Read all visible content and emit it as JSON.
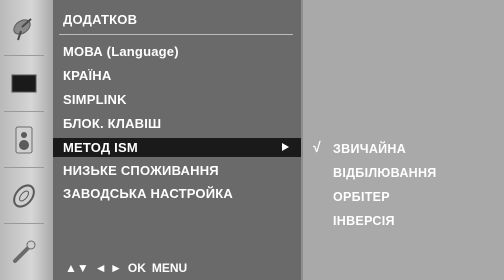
{
  "menu": {
    "title": "ДОДАТКОВ",
    "items": [
      {
        "label": "МОВА (Language)"
      },
      {
        "label": "КРАЇНА"
      },
      {
        "label": "SIMPLINK"
      },
      {
        "label": "БЛОК. КЛАВІШ"
      },
      {
        "label": "МЕТОД ISM",
        "selected": true
      },
      {
        "label": "НИЗЬКЕ СПОЖИВАННЯ"
      },
      {
        "label": "ЗАВОДСЬКА НАСТРОЙКА"
      }
    ]
  },
  "submenu": {
    "check": "√",
    "items": [
      {
        "label": "ЗВИЧАЙНА",
        "checked": true
      },
      {
        "label": "ВІДБІЛЮВАННЯ"
      },
      {
        "label": "ОРБІТЕР"
      },
      {
        "label": "ІНВЕРСІЯ"
      }
    ]
  },
  "nav_legend": {
    "updown": "▲▼",
    "leftright": "◄ ►",
    "ok": "OK",
    "menu": "MENU"
  },
  "icons": [
    "satellite-dish-icon",
    "screen-icon",
    "speaker-icon",
    "disc-icon",
    "option-tool-icon"
  ],
  "colors": {
    "menu_bg": "#6a6a6a",
    "selected_bg": "#1a1a1a",
    "submenu_bg": "#a9a9a9",
    "icon_strip": "#c8c8c8"
  }
}
